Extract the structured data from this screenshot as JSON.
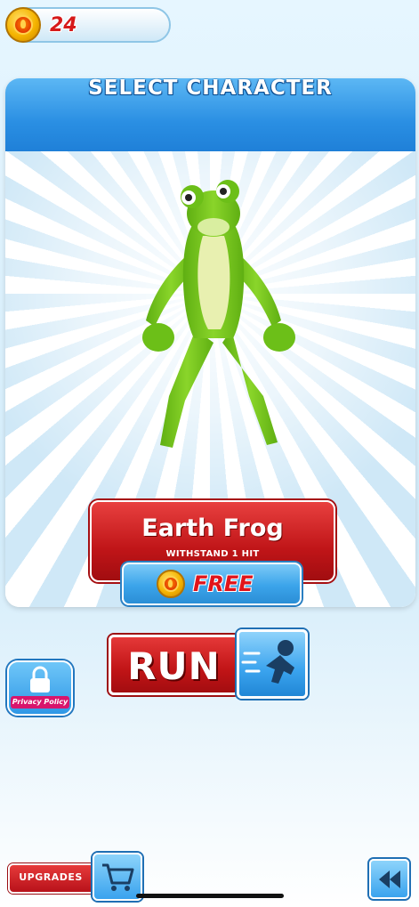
{
  "hud": {
    "coins": "24"
  },
  "panel": {
    "title": "SELECT CHARACTER"
  },
  "character": {
    "name": "Earth Frog",
    "ability": "WITHSTAND 1 HIT",
    "price": "FREE"
  },
  "buttons": {
    "run": "RUN",
    "privacy": "Privacy Policy",
    "upgrades": "UPGRADES"
  },
  "icons": {
    "coin": "coin-icon",
    "runner": "runner-icon",
    "lock": "lock-icon",
    "cart": "cart-icon",
    "back": "back-arrow-icon"
  },
  "colors": {
    "accent_blue": "#2a8fe3",
    "accent_red": "#c01518",
    "frog_green": "#7fcf1f"
  }
}
